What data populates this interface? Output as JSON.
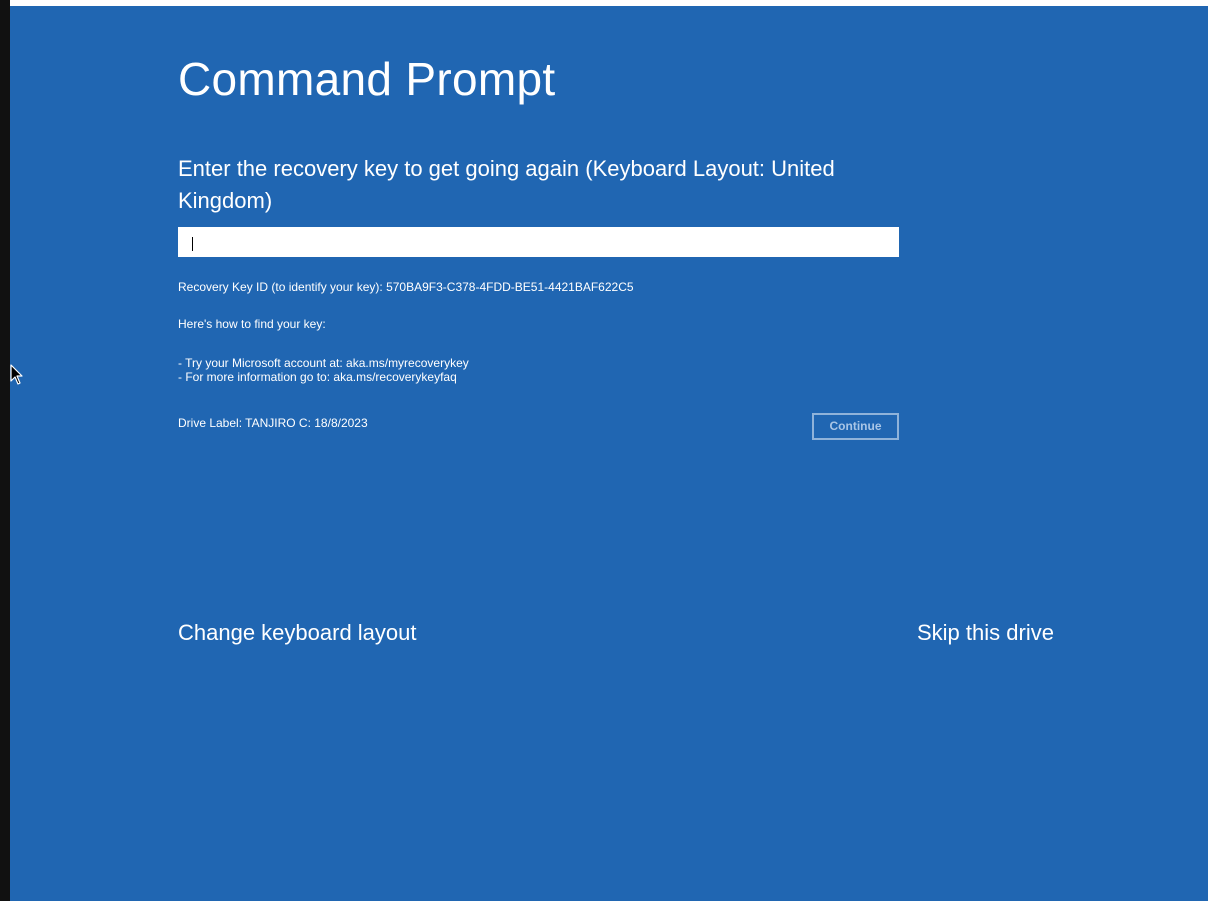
{
  "screen": {
    "title": "Command Prompt",
    "prompt": "Enter the recovery key to get going again (Keyboard Layout: United Kingdom)",
    "recovery_input": {
      "value": "",
      "placeholder": ""
    },
    "key_id_text": "Recovery Key ID (to identify your key): 570BA9F3-C378-4FDD-BE51-4421BAF622C5",
    "how_to_text": "Here's how to find your key:",
    "hints": [
      "- Try your Microsoft account at: aka.ms/myrecoverykey",
      "- For more information go to: aka.ms/recoverykeyfaq"
    ],
    "drive_label": "Drive Label: TANJIRO C: 18/8/2023",
    "continue_label": "Continue",
    "change_layout_label": "Change keyboard layout",
    "skip_drive_label": "Skip this drive"
  },
  "icons": {
    "mouse_cursor": "arrow-cursor-icon"
  },
  "colors": {
    "background": "#2066b2",
    "text": "#ffffff",
    "disabled_button_border": "#8fb3da",
    "disabled_button_text": "#a9c6e6"
  }
}
